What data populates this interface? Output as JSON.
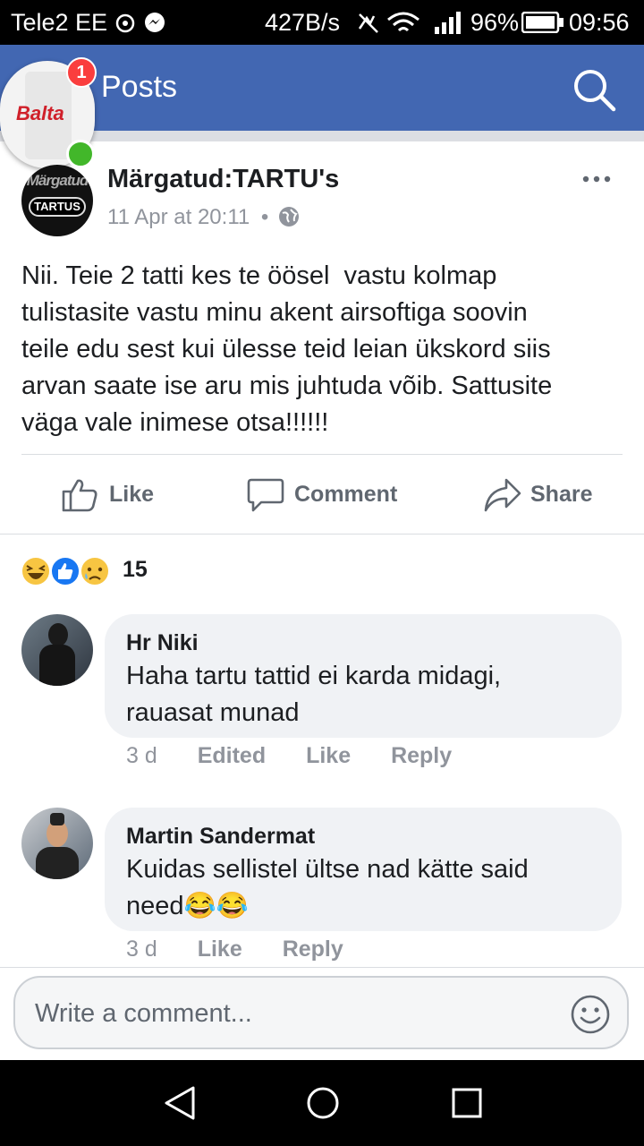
{
  "status_bar": {
    "carrier": "Tele2 EE",
    "speed": "427B/s",
    "battery": "96%",
    "time": "09:56"
  },
  "header": {
    "title": "Posts",
    "chat_head_badge": "1",
    "chat_head_logo_text": "Balta"
  },
  "post": {
    "page_name": "Märgatud:TARTU's",
    "avatar_text_top": "Märgatud",
    "avatar_text": "TARTUS",
    "timestamp": "11 Apr at 20:11",
    "separator": "•",
    "text_lines": [
      "Nii. Teie 2 tatti kes te öösel  vastu kolmap",
      "tulistasite vastu minu akent airsoftiga soovin",
      "teile edu sest kui ülesse teid leian ükskord siis",
      "arvan saate ise aru mis juhtuda võib. Sattusite",
      "väga vale inimese otsa!!!!!!"
    ]
  },
  "actions": {
    "like": "Like",
    "comment": "Comment",
    "share": "Share"
  },
  "reactions": {
    "count": "15",
    "types": [
      "haha-icon",
      "like-icon",
      "sad-icon"
    ]
  },
  "comments": [
    {
      "author": "Hr Niki",
      "lines": [
        "Haha tartu tattid ei karda midagi,",
        "rauasat munad"
      ],
      "age": "3 d",
      "edited": "Edited",
      "like": "Like",
      "reply": "Reply"
    },
    {
      "author": "Martin Sandermat",
      "lines": [
        "Kuidas sellistel ültse nad kätte said",
        "need😂😂"
      ],
      "age": "3 d",
      "like": "Like",
      "reply": "Reply"
    }
  ],
  "composer": {
    "placeholder": "Write a comment..."
  },
  "colors": {
    "header": "#4267b2",
    "bubble": "#f0f2f5",
    "muted_text": "#90949c",
    "action_text": "#606770",
    "online_dot": "#42b72a",
    "badge": "#fa3e3e"
  }
}
